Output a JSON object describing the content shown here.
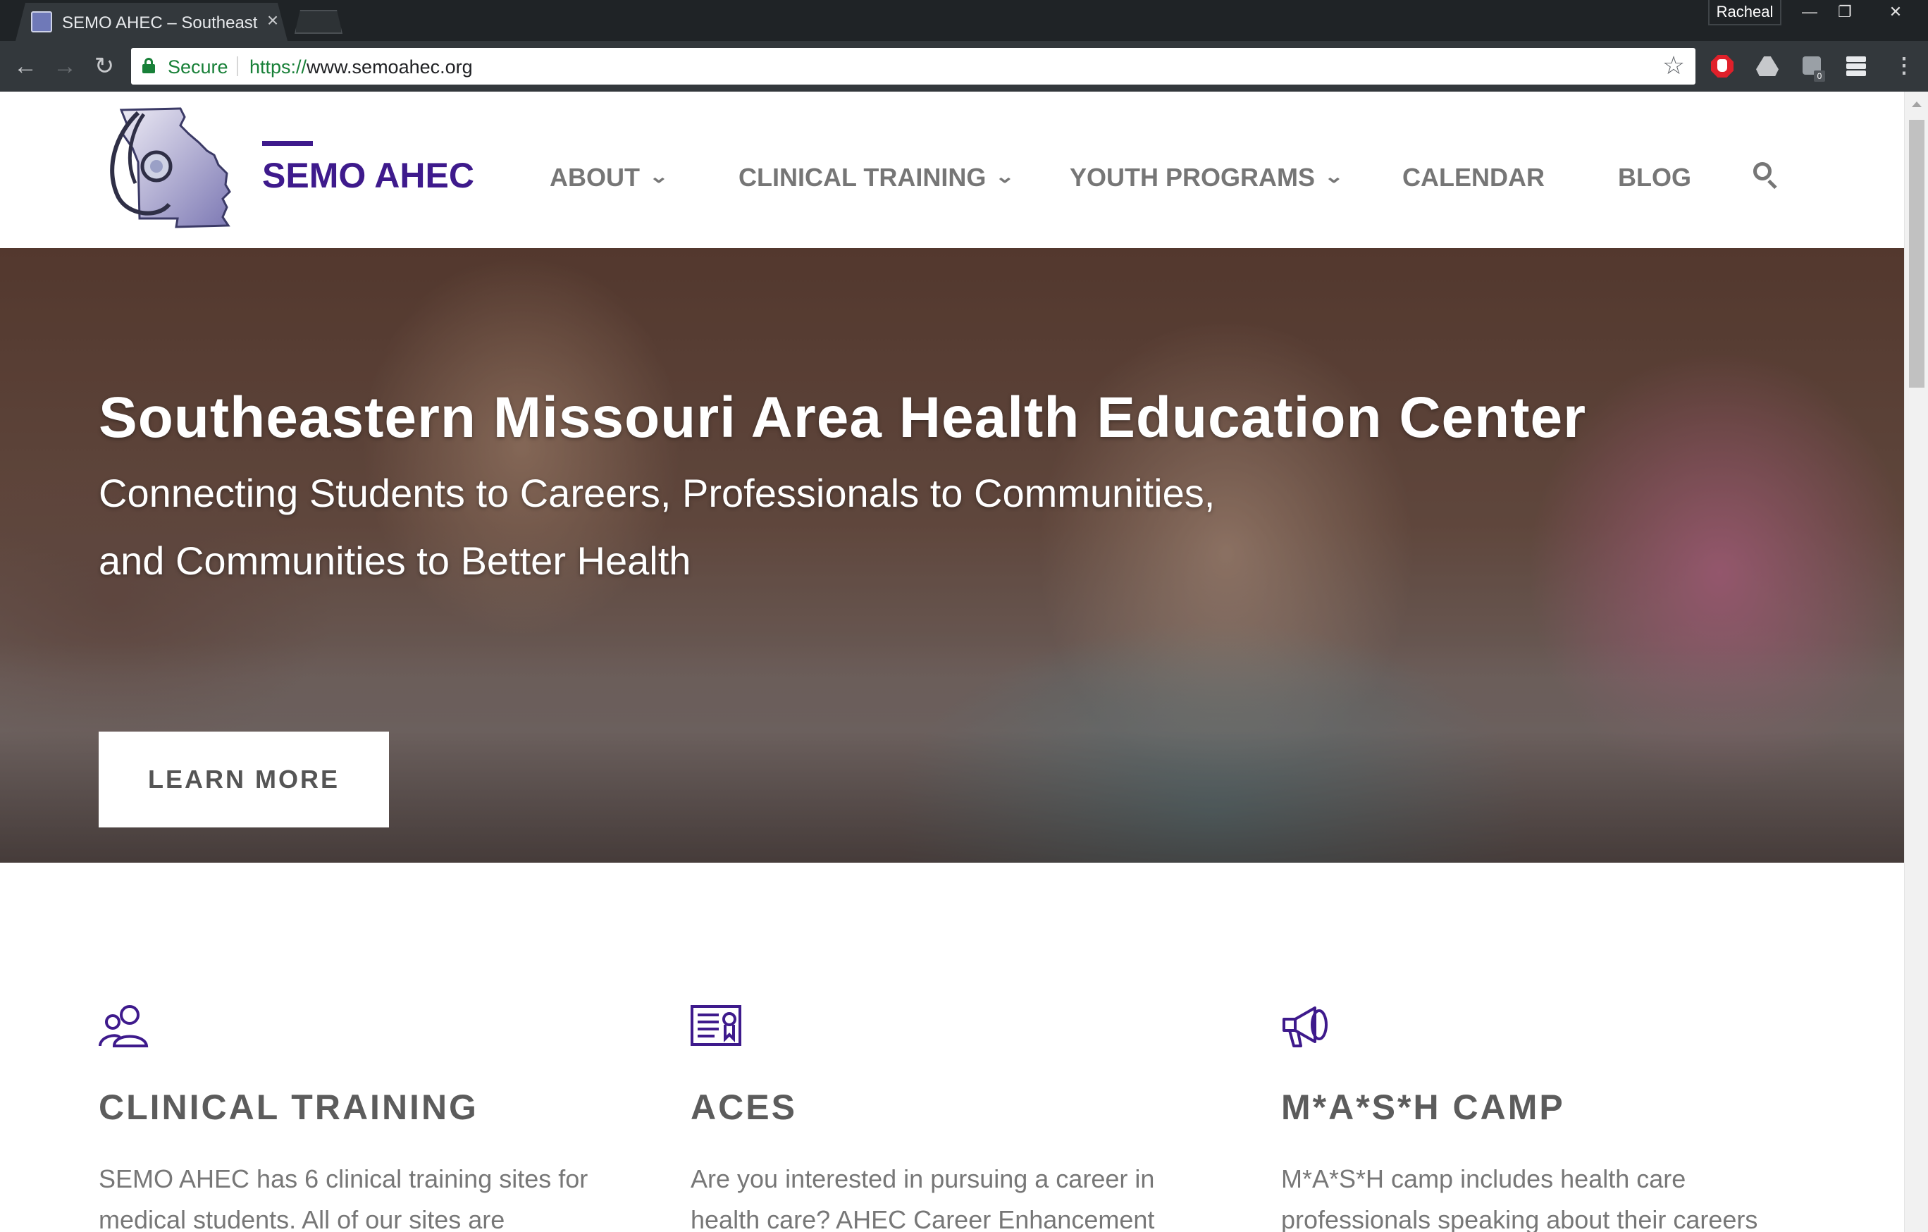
{
  "browser": {
    "tab_title": "SEMO AHEC – Southeast",
    "profile_name": "Racheal",
    "secure_label": "Secure",
    "url_scheme": "https://",
    "url_host": "www.semoahec.org",
    "extension_badge": "0"
  },
  "site": {
    "logo_text": "SEMO AHEC",
    "nav": [
      {
        "label": "ABOUT",
        "has_dropdown": true
      },
      {
        "label": "CLINICAL TRAINING",
        "has_dropdown": true
      },
      {
        "label": "YOUTH PROGRAMS",
        "has_dropdown": true
      },
      {
        "label": "CALENDAR",
        "has_dropdown": false
      },
      {
        "label": "BLOG",
        "has_dropdown": false
      }
    ]
  },
  "hero": {
    "title": "Southeastern Missouri Area Health Education Center",
    "subtitle_line1": "Connecting Students to Careers, Professionals to Communities,",
    "subtitle_line2": "and Communities to Better Health",
    "button_label": "LEARN MORE"
  },
  "features": [
    {
      "icon": "people-icon",
      "title": "CLINICAL TRAINING",
      "text": "SEMO AHEC has 6 clinical training sites for medical students.  All of our sites are"
    },
    {
      "icon": "certificate-icon",
      "title": "ACES",
      "text": "Are you interested in pursuing a career in health care? AHEC Career Enhancement"
    },
    {
      "icon": "megaphone-icon",
      "title": "M*A*S*H CAMP",
      "text": "M*A*S*H camp includes health care professionals speaking about their careers"
    }
  ],
  "colors": {
    "brand_purple": "#3e1a8c",
    "nav_gray": "#767676",
    "secure_green": "#188038"
  }
}
